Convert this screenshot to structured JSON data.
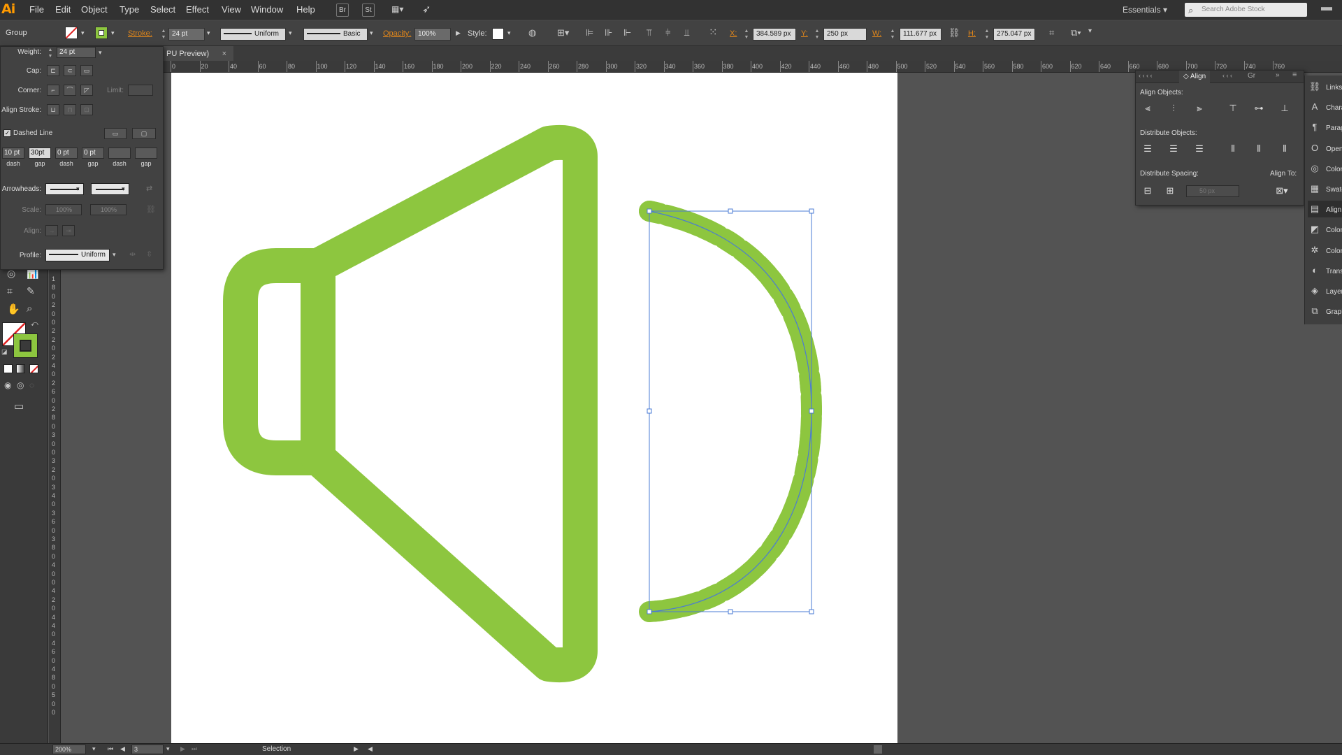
{
  "app": {
    "logo": "Ai"
  },
  "menu": [
    "File",
    "Edit",
    "Object",
    "Type",
    "Select",
    "Effect",
    "View",
    "Window",
    "Help"
  ],
  "menubar_buttons": {
    "bridge": "Br",
    "stock": "St"
  },
  "workspace": "Essentials",
  "search_placeholder": "Search Adobe Stock",
  "control": {
    "selection_type": "Group",
    "stroke_label": "Stroke:",
    "stroke_weight": "24 pt",
    "profile": "Uniform",
    "brush": "Basic",
    "opacity_label": "Opacity:",
    "opacity": "100%",
    "style_label": "Style:",
    "x_label": "X:",
    "x": "384.589 px",
    "y_label": "Y:",
    "y": "250 px",
    "w_label": "W:",
    "w": "111.677 px",
    "h_label": "H:",
    "h": "275.047 px"
  },
  "doc_tab": {
    "title": "PU Preview)",
    "close": "×"
  },
  "ruler_h": [
    "0",
    "20",
    "40",
    "60",
    "80",
    "100",
    "120",
    "140",
    "160",
    "180",
    "200",
    "220",
    "240",
    "260",
    "280",
    "300",
    "320",
    "340",
    "360",
    "380",
    "400",
    "420",
    "440",
    "460",
    "480",
    "500",
    "520",
    "540",
    "560",
    "580",
    "600",
    "620",
    "640",
    "660",
    "680",
    "700",
    "720",
    "740",
    "760"
  ],
  "ruler_v": [
    "1",
    "8",
    "0",
    "2",
    "0",
    "0",
    "2",
    "2",
    "0",
    "2",
    "4",
    "0",
    "2",
    "6",
    "0",
    "2",
    "8",
    "0",
    "3",
    "0",
    "0",
    "3",
    "2",
    "0",
    "3",
    "4",
    "0",
    "3",
    "6",
    "0",
    "3",
    "8",
    "0",
    "4",
    "0",
    "0",
    "4",
    "2",
    "0",
    "4",
    "4",
    "0",
    "4",
    "6",
    "0",
    "4",
    "8",
    "0",
    "5",
    "0",
    "0"
  ],
  "stroke_panel": {
    "weight_label": "Weight:",
    "weight": "24 pt",
    "cap_label": "Cap:",
    "corner_label": "Corner:",
    "limit_label": "Limit:",
    "align_stroke_label": "Align Stroke:",
    "dashed_line_label": "Dashed Line",
    "dashed_checked": true,
    "dash_values": [
      "10 pt",
      "30pt",
      "0 pt",
      "0 pt",
      "",
      ""
    ],
    "dash_labels": [
      "dash",
      "gap",
      "dash",
      "gap",
      "dash",
      "gap"
    ],
    "arrowheads_label": "Arrowheads:",
    "scale_label": "Scale:",
    "scale_start": "100%",
    "scale_end": "100%",
    "align_label": "Align:",
    "profile_label": "Profile:",
    "profile": "Uniform"
  },
  "align_panel": {
    "tabs": [
      "Align",
      "Gr"
    ],
    "align_objects": "Align Objects:",
    "distribute_objects": "Distribute Objects:",
    "distribute_spacing": "Distribute Spacing:",
    "align_to": "Align To:",
    "spacing_value": "50 px"
  },
  "dock": [
    {
      "icon": "link-icon",
      "label": "Links"
    },
    {
      "icon": "character-icon",
      "label": "Character"
    },
    {
      "icon": "paragraph-icon",
      "label": "Paragraph"
    },
    {
      "icon": "opentype-icon",
      "label": "OpenType"
    },
    {
      "icon": "color-guide-icon",
      "label": "Color"
    },
    {
      "icon": "swatches-icon",
      "label": "Swatches"
    },
    {
      "icon": "align-icon",
      "label": "Align"
    },
    {
      "icon": "color-icon",
      "label": "Color"
    },
    {
      "icon": "color-theme-icon",
      "label": "Color"
    },
    {
      "icon": "transparency-icon",
      "label": "Transparency"
    },
    {
      "icon": "layers-icon",
      "label": "Layers"
    },
    {
      "icon": "graphic-styles-icon",
      "label": "Graphic Styles"
    }
  ],
  "status": {
    "zoom": "200%",
    "artboard": "3",
    "tool": "Selection"
  },
  "colors": {
    "accent_green": "#8dc63f",
    "selection_blue": "#4a7bd4",
    "ui_dark": "#424242",
    "highlight_orange": "#e0861a"
  }
}
